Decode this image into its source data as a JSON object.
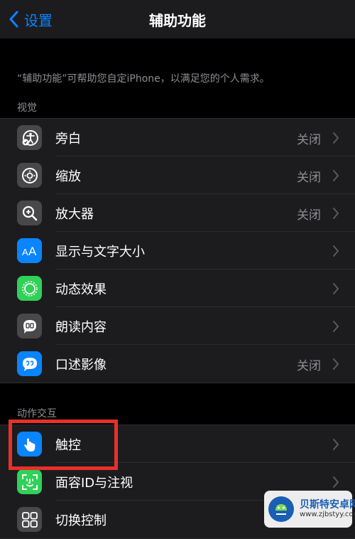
{
  "nav": {
    "back_label": "设置",
    "title": "辅助功能"
  },
  "description": "“辅助功能”可帮助您自定iPhone，以满足您的个人需求。",
  "sections": {
    "vision": {
      "header": "视觉",
      "items": [
        {
          "label": "旁白",
          "value": "关闭",
          "icon": "voiceover-icon",
          "color": "#48484a"
        },
        {
          "label": "缩放",
          "value": "关闭",
          "icon": "zoom-icon",
          "color": "#48484a"
        },
        {
          "label": "放大器",
          "value": "关闭",
          "icon": "magnifier-icon",
          "color": "#48484a"
        },
        {
          "label": "显示与文字大小",
          "value": "",
          "icon": "text-size-icon",
          "color": "#0a84ff"
        },
        {
          "label": "动态效果",
          "value": "",
          "icon": "motion-icon",
          "color": "#30d158"
        },
        {
          "label": "朗读内容",
          "value": "",
          "icon": "spoken-content-icon",
          "color": "#48484a"
        },
        {
          "label": "口述影像",
          "value": "关闭",
          "icon": "audio-description-icon",
          "color": "#0a84ff"
        }
      ]
    },
    "interaction": {
      "header": "动作交互",
      "items": [
        {
          "label": "触控",
          "value": "",
          "icon": "touch-icon",
          "color": "#0a84ff"
        },
        {
          "label": "面容ID与注视",
          "value": "",
          "icon": "face-id-icon",
          "color": "#30d158"
        },
        {
          "label": "切换控制",
          "value": "",
          "icon": "switch-control-icon",
          "color": "#48484a"
        }
      ]
    }
  },
  "watermark": {
    "title": "贝斯特安卓网",
    "url": "www.zjbstyy.com"
  },
  "colors": {
    "accent": "#0a84ff",
    "highlight": "#e8302a",
    "background": "#000000",
    "cell": "#1c1c1e"
  }
}
